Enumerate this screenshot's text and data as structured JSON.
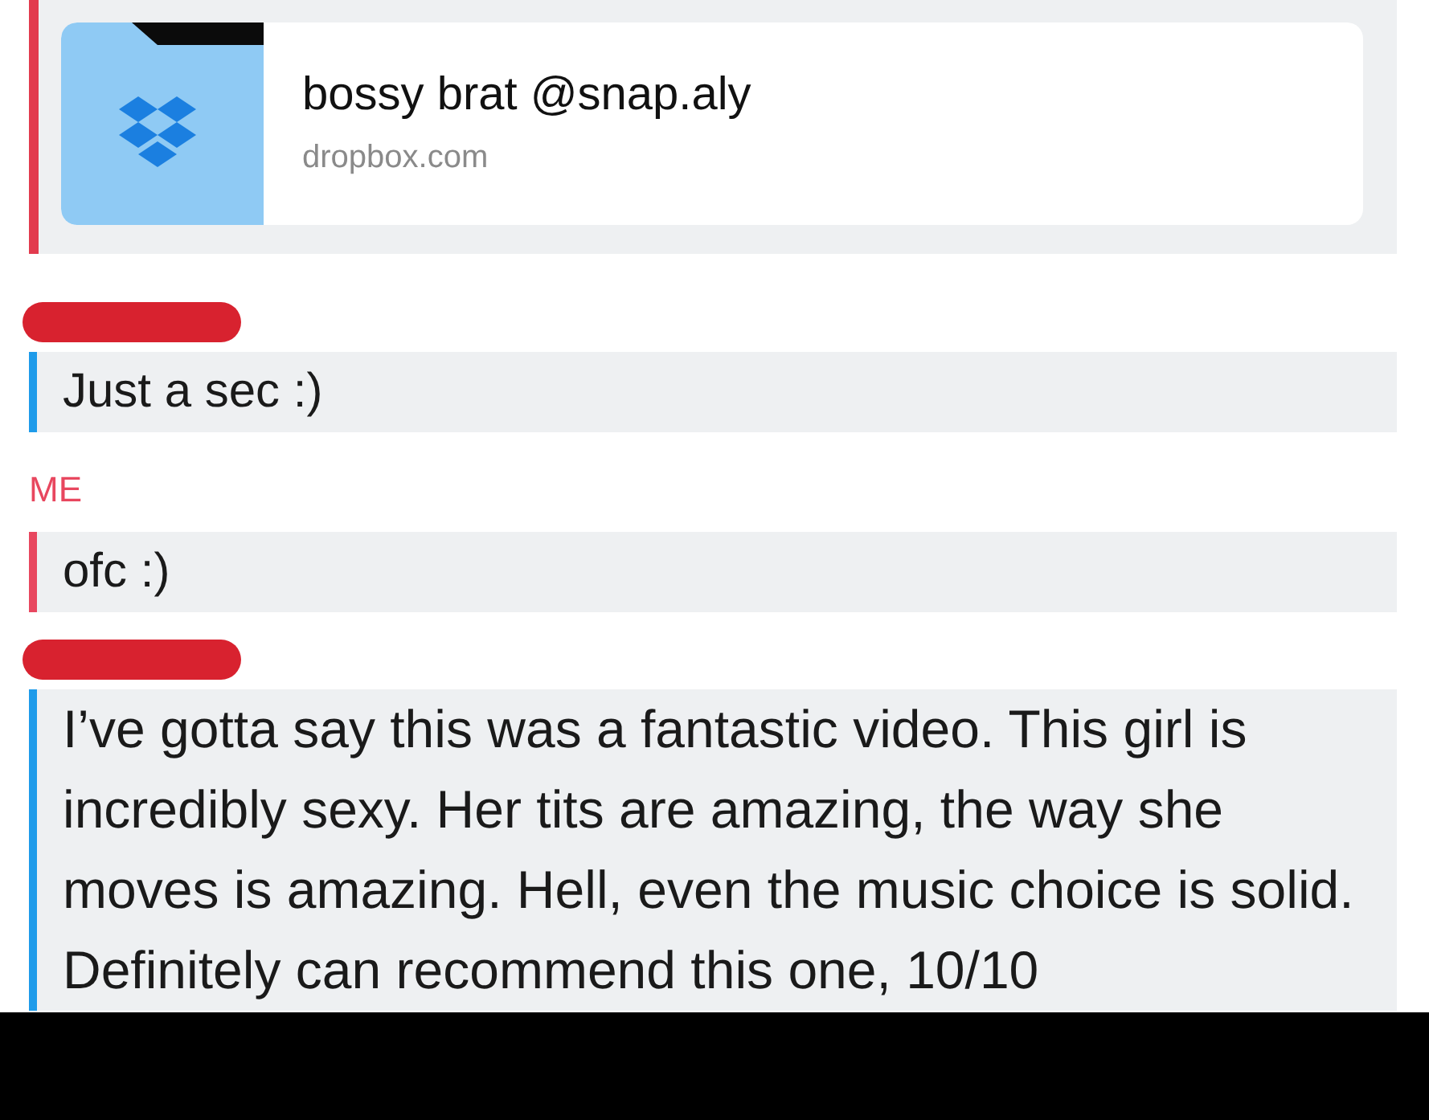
{
  "attachment": {
    "title": "bossy brat @snap.aly",
    "domain": "dropbox.com",
    "color": "#e23b4e"
  },
  "messages": [
    {
      "sender_redacted": true,
      "color": "#1e9bea",
      "text": "Just a sec :)"
    },
    {
      "sender": "ME",
      "color": "#e8475f",
      "text": "ofc :)"
    },
    {
      "sender_redacted": true,
      "color": "#1e9bea",
      "text": "I’ve gotta say this was a fantastic video. This girl is incredibly sexy. Her tits are amazing, the way she moves is amazing. Hell, even the music choice is solid. Definitely can recommend this one, 10/10"
    }
  ]
}
